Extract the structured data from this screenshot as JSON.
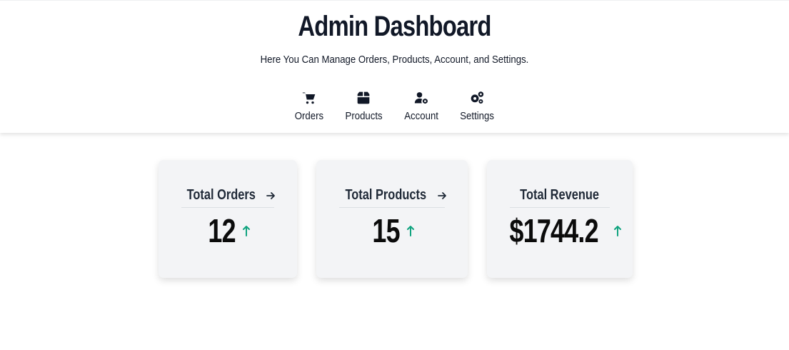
{
  "header": {
    "title": "Admin Dashboard",
    "subtitle": "Here You Can Manage Orders, Products, Account, and Settings."
  },
  "nav": {
    "items": [
      {
        "label": "Orders",
        "icon": "cart-icon"
      },
      {
        "label": "Products",
        "icon": "box-icon"
      },
      {
        "label": "Account",
        "icon": "user-gear-icon"
      },
      {
        "label": "Settings",
        "icon": "gears-icon"
      }
    ]
  },
  "cards": [
    {
      "title": "Total Orders",
      "value": "12",
      "has_arrow": true
    },
    {
      "title": "Total Products",
      "value": "15",
      "has_arrow": true
    },
    {
      "title": "Total Revenue",
      "value": "$1744.2",
      "has_arrow": false
    }
  ],
  "colors": {
    "text": "#111827",
    "card_bg": "#f3f4f6",
    "trend_up": "#10a37f"
  }
}
